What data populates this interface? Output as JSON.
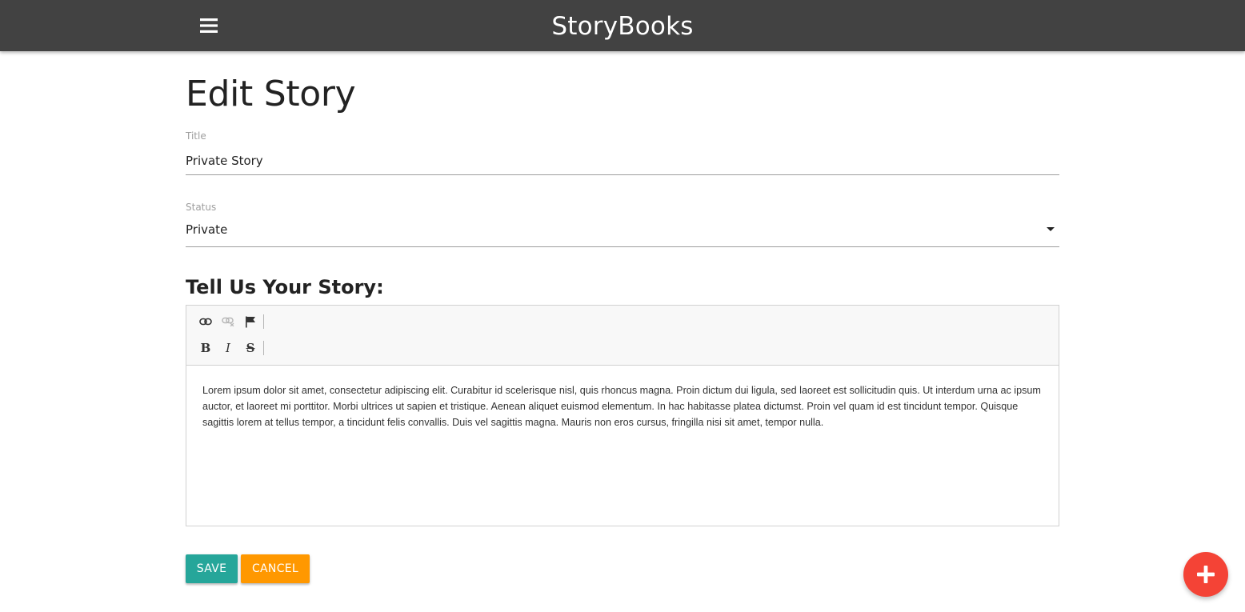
{
  "navbar": {
    "brand": "StoryBooks",
    "menu_icon": "hamburger-menu-icon",
    "background_color": "#424242"
  },
  "page": {
    "title": "Edit Story"
  },
  "form": {
    "title_field": {
      "label": "Title",
      "value": "Private Story"
    },
    "status_field": {
      "label": "Status",
      "selected": "Private"
    },
    "story_heading": "Tell Us Your Story:",
    "editor": {
      "toolbar_row1": [
        "link-icon",
        "unlink-icon",
        "anchor-flag-icon"
      ],
      "toolbar_row2": [
        "bold-icon",
        "italic-icon",
        "strikethrough-icon"
      ],
      "toolbar_labels": {
        "bold": "B",
        "italic": "I",
        "strike": "S"
      },
      "content": "Lorem ipsum dolor sit amet, consectetur adipiscing elit. Curabitur id scelerisque nisl, quis rhoncus magna. Proin dictum dui ligula, sed laoreet est sollicitudin quis. Ut interdum urna ac ipsum auctor, et laoreet mi porttitor. Morbi ultrices ut sapien et tristique. Aenean aliquet euismod elementum. In hac habitasse platea dictumst. Proin vel quam id est tincidunt tempor. Quisque sagittis lorem at tellus tempor, a tincidunt felis convallis. Duis vel sagittis magna. Mauris non eros cursus, fringilla nisi sit amet, tempor nulla."
    },
    "save_label": "Save",
    "cancel_label": "Cancel"
  },
  "fab": {
    "icon": "add-icon",
    "color": "#f44336"
  },
  "colors": {
    "save": "#26a69a",
    "cancel": "#ff9800"
  }
}
